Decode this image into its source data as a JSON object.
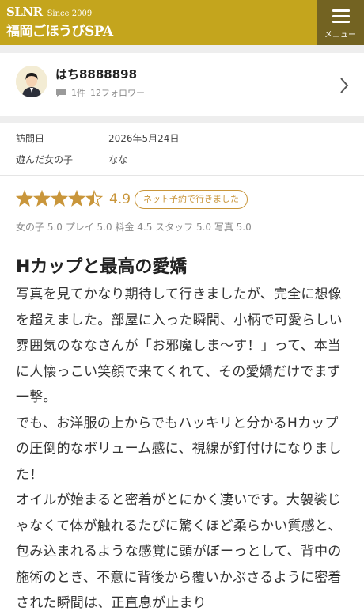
{
  "header": {
    "logo_brand": "SLNR",
    "logo_since": "Since 2009",
    "logo_name": "福岡ごほうびSPA",
    "menu_label": "メニュー"
  },
  "user": {
    "name": "はち8888898",
    "review_count": "1件",
    "followers": "12フォロワー"
  },
  "visit": {
    "date_label": "訪問日",
    "date_value": "2026年5月24日",
    "girl_label": "遊んだ女の子",
    "girl_value": "なな"
  },
  "rating": {
    "stars": 4.5,
    "score": "4.9",
    "badge": "ネット予約で行きました",
    "subscores": "女の子 5.0 プレイ 5.0 料金 4.5 スタッフ 5.0 写真 5.0",
    "star_color": "#c9963b"
  },
  "review": {
    "title": "Hカップと最高の愛嬌",
    "paragraphs": [
      "写真を見てかなり期待して行きましたが、完全に想像を超えました。部屋に入った瞬間、小柄で可愛らしい雰囲気のななさんが「お邪魔しま〜す！」って、本当に人懐っこい笑顔で来てくれて、その愛嬌だけでまず一撃。",
      "でも、お洋服の上からでもハッキリと分かるHカップの圧倒的なボリューム感に、視線が釘付けになりました！",
      "オイルが始まると密着がとにかく凄いです。大袈裟じゃなくて体が触れるたびに驚くほど柔らかい質感と、包み込まれるような感覚に頭がぼーっとして、背中の施術のとき、不意に背後から覆いかぶさるように密着された瞬間は、正直息が止まり"
    ]
  },
  "colors": {
    "header_bg": "#c4a51d",
    "menu_bg": "#736322",
    "accent": "#c9963b"
  }
}
